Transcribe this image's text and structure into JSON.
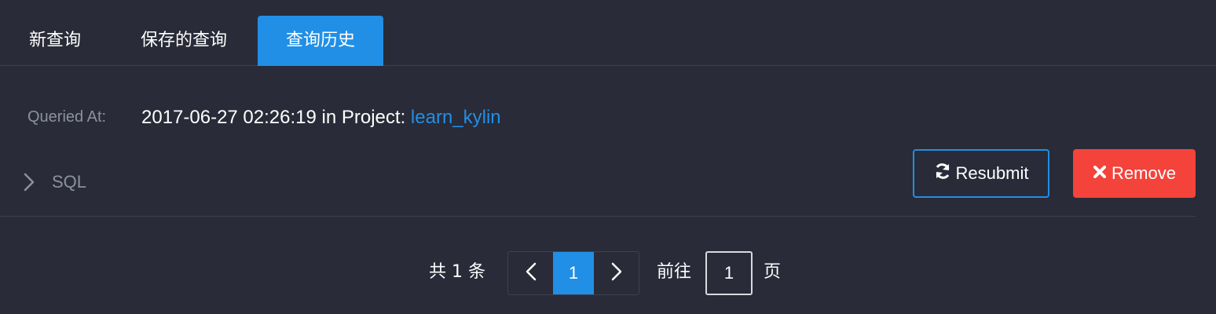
{
  "tabs": [
    {
      "label": "新查询",
      "active": false
    },
    {
      "label": "保存的查询",
      "active": false
    },
    {
      "label": "查询历史",
      "active": true
    }
  ],
  "query": {
    "queried_at_label": "Queried At:",
    "timestamp": "2017-06-27 02:26:19",
    "in_project_text": "in Project:",
    "project": "learn_kylin",
    "sql_label": "SQL"
  },
  "actions": {
    "resubmit_label": "Resubmit",
    "remove_label": "Remove"
  },
  "pagination": {
    "total_text": "共 1 条",
    "current_page": "1",
    "goto_label": "前往",
    "goto_value": "1",
    "page_unit": "页"
  },
  "icons": {
    "sql_toggle": "chevron-right-icon",
    "resubmit": "refresh-icon",
    "remove": "close-icon",
    "prev": "chevron-left-icon",
    "next": "chevron-right-icon"
  },
  "colors": {
    "background": "#292b38",
    "accent": "#218fe6",
    "danger": "#f3433b",
    "muted_text": "#8d909e",
    "divider": "#3d4150"
  }
}
